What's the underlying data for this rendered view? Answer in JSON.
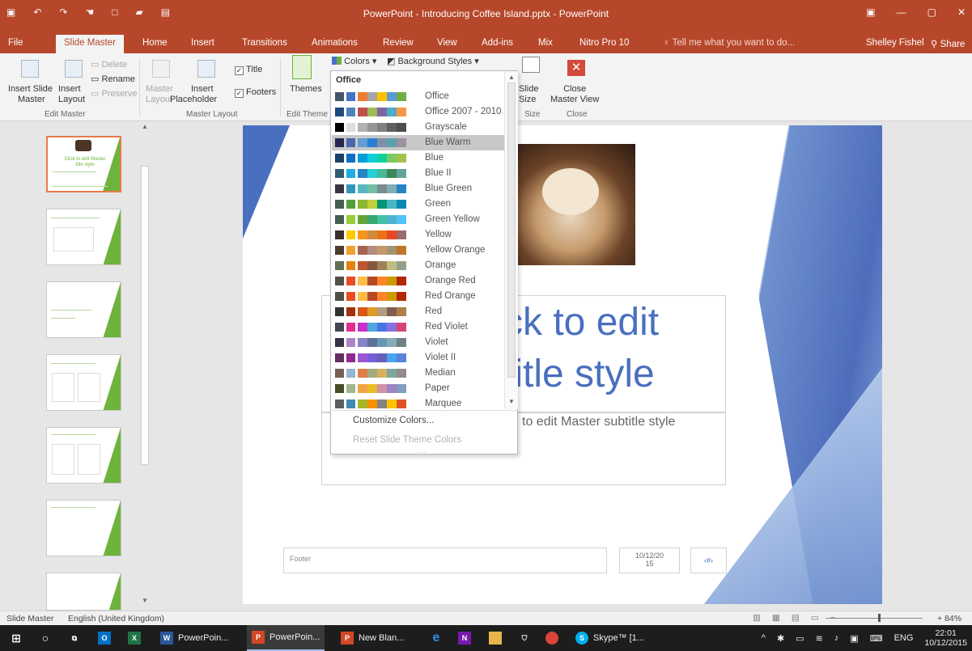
{
  "window": {
    "title": "PowerPoint - Introducing Coffee Island.pptx - PowerPoint",
    "user": "Shelley Fishel",
    "share": "Share"
  },
  "tabs": [
    "File",
    "Slide Master",
    "Home",
    "Insert",
    "Transitions",
    "Animations",
    "Review",
    "View",
    "Add-ins",
    "Mix",
    "Nitro Pro 10"
  ],
  "tell_me": "Tell me what you want to do...",
  "ribbon": {
    "insert_slide_master": [
      "Insert Slide",
      "Master"
    ],
    "insert_layout": [
      "Insert",
      "Layout"
    ],
    "delete": "Delete",
    "rename": "Rename",
    "preserve": "Preserve",
    "master_layout": [
      "Master",
      "Layout"
    ],
    "insert_placeholder": [
      "Insert",
      "Placeholder"
    ],
    "title_check": "Title",
    "footers_check": "Footers",
    "themes": "Themes",
    "colors": "Colors",
    "background_styles": "Background Styles",
    "slide_size": [
      "Slide",
      "Size"
    ],
    "close_master_view": [
      "Close",
      "Master View"
    ],
    "groups": {
      "edit_master": "Edit Master",
      "master_layout": "Master Layout",
      "edit_theme": "Edit Theme",
      "size": "Size",
      "close": "Close"
    }
  },
  "thumb_texts": [
    "Click to edit Master title style"
  ],
  "slide": {
    "title_line1": "ck to edit",
    "title_line2": "title style",
    "subtitle": "to edit Master subtitle style",
    "footer": "Footer",
    "date_line1": "10/12/20",
    "date_line2": "15",
    "number": "‹#›"
  },
  "colors_dropdown": {
    "header": "Office",
    "highlighted": "Blue Warm",
    "schemes": [
      {
        "name": "Office",
        "swatches": [
          "#ffffff",
          "#44546a",
          "#4472c4",
          "#ed7d31",
          "#a5a5a5",
          "#ffc000",
          "#5b9bd5",
          "#70ad47"
        ]
      },
      {
        "name": "Office 2007 - 2010",
        "swatches": [
          "#ffffff",
          "#1f497d",
          "#4f81bd",
          "#c0504d",
          "#9bbb59",
          "#8064a2",
          "#4bacc6",
          "#f79646"
        ]
      },
      {
        "name": "Grayscale",
        "swatches": [
          "#ffffff",
          "#000000",
          "#dddddd",
          "#b2b2b2",
          "#969696",
          "#808080",
          "#5f5f5f",
          "#4d4d4d"
        ]
      },
      {
        "name": "Blue Warm",
        "swatches": [
          "#ffffff",
          "#242852",
          "#4a66ac",
          "#629dd1",
          "#297fd5",
          "#7f8fa9",
          "#5aa2ae",
          "#9d90a0"
        ]
      },
      {
        "name": "Blue",
        "swatches": [
          "#ffffff",
          "#17406d",
          "#0f6fc6",
          "#009dd9",
          "#0bd0d9",
          "#10cf9b",
          "#7cca62",
          "#a5c249"
        ]
      },
      {
        "name": "Blue II",
        "swatches": [
          "#ffffff",
          "#335b74",
          "#1cade4",
          "#2683c6",
          "#27ced7",
          "#42ba97",
          "#3e8853",
          "#62a39f"
        ]
      },
      {
        "name": "Blue Green",
        "swatches": [
          "#ffffff",
          "#373545",
          "#3494ba",
          "#58b6c0",
          "#75bda7",
          "#7a8c8e",
          "#84acb6",
          "#2683c6"
        ]
      },
      {
        "name": "Green",
        "swatches": [
          "#ffffff",
          "#455f51",
          "#549e39",
          "#8ab833",
          "#c0cf3a",
          "#029676",
          "#4ab5c4",
          "#0989b1"
        ]
      },
      {
        "name": "Green Yellow",
        "swatches": [
          "#ffffff",
          "#455f51",
          "#99cb38",
          "#63a537",
          "#37a76f",
          "#44c1a3",
          "#4eb3cf",
          "#51c3f9"
        ]
      },
      {
        "name": "Yellow",
        "swatches": [
          "#ffffff",
          "#39302a",
          "#ffca08",
          "#f8931d",
          "#ce8d3e",
          "#ec7016",
          "#e64823",
          "#9c6a6a"
        ]
      },
      {
        "name": "Yellow Orange",
        "swatches": [
          "#ffffff",
          "#4e3b30",
          "#f0a22e",
          "#a5644e",
          "#b58b80",
          "#c3986d",
          "#a19574",
          "#c17529"
        ]
      },
      {
        "name": "Orange",
        "swatches": [
          "#ffffff",
          "#637052",
          "#e48312",
          "#bd582c",
          "#865640",
          "#9b8357",
          "#c2bc80",
          "#94a088"
        ]
      },
      {
        "name": "Orange Red",
        "swatches": [
          "#ffffff",
          "#505046",
          "#e84c22",
          "#ffbd47",
          "#b64926",
          "#ff8427",
          "#cc9900",
          "#b22600"
        ]
      },
      {
        "name": "Red Orange",
        "swatches": [
          "#ffffff",
          "#505046",
          "#e84c22",
          "#ffbd47",
          "#b64926",
          "#ff8427",
          "#cc9900",
          "#b22600"
        ]
      },
      {
        "name": "Red",
        "swatches": [
          "#ffffff",
          "#323232",
          "#a5300f",
          "#d55816",
          "#e19825",
          "#b19c7d",
          "#7f5f52",
          "#b27d49"
        ]
      },
      {
        "name": "Red Violet",
        "swatches": [
          "#ffffff",
          "#454551",
          "#e32d91",
          "#c830cc",
          "#4ea6dc",
          "#4775e7",
          "#8971e1",
          "#d54773"
        ]
      },
      {
        "name": "Violet",
        "swatches": [
          "#ffffff",
          "#373545",
          "#ad84c6",
          "#8784c7",
          "#5d739a",
          "#6997af",
          "#84acb6",
          "#6f8183"
        ]
      },
      {
        "name": "Violet II",
        "swatches": [
          "#ffffff",
          "#632e62",
          "#92278f",
          "#9b57d3",
          "#755dd9",
          "#665eb8",
          "#45a5ed",
          "#5982db"
        ]
      },
      {
        "name": "Median",
        "swatches": [
          "#ffffff",
          "#775f55",
          "#94b6d2",
          "#dd8047",
          "#a5ab81",
          "#d8b25c",
          "#7ba79d",
          "#968c8c"
        ]
      },
      {
        "name": "Paper",
        "swatches": [
          "#ffffff",
          "#444d26",
          "#a5b592",
          "#f3a447",
          "#e7bc29",
          "#d092a7",
          "#9c85c0",
          "#809ec2"
        ]
      },
      {
        "name": "Marquee",
        "swatches": [
          "#ffffff",
          "#5e5e5e",
          "#418ab3",
          "#a6b727",
          "#f69200",
          "#838383",
          "#fec306",
          "#df5327"
        ]
      }
    ],
    "customize": "Customize Colors...",
    "reset": "Reset Slide Theme Colors"
  },
  "status": {
    "view": "Slide Master",
    "language": "English (United Kingdom)",
    "zoom": "84%"
  },
  "taskbar": {
    "apps": [
      "PowerPoin...",
      "PowerPoin...",
      "New Blan...",
      "Skype™ [1..."
    ],
    "lang": "ENG",
    "time": "22:01",
    "date": "10/12/2015"
  }
}
